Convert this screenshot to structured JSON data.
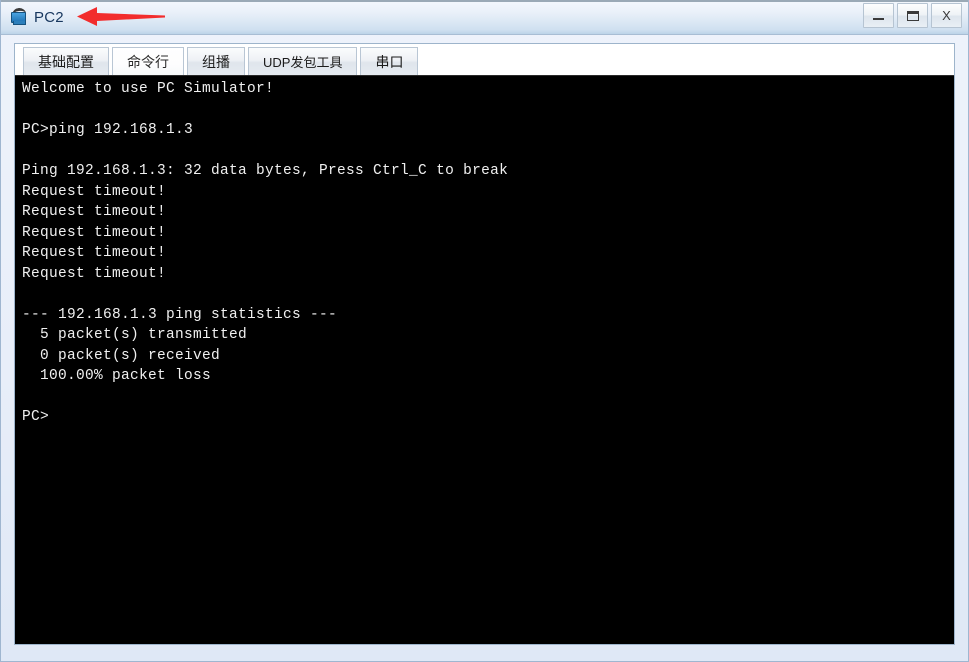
{
  "window": {
    "title": "PC2",
    "icon": "pc-computer-icon",
    "annotation_arrow_color": "#f22d2d",
    "controls": {
      "minimize": "–",
      "maximize": "□",
      "close": "X"
    }
  },
  "tabs": [
    {
      "label": "基础配置",
      "active": false,
      "name": "tab-basic-config"
    },
    {
      "label": "命令行",
      "active": true,
      "name": "tab-command-line"
    },
    {
      "label": "组播",
      "active": false,
      "name": "tab-multicast"
    },
    {
      "label": "UDP发包工具",
      "active": false,
      "name": "tab-udp-tool"
    },
    {
      "label": "串口",
      "active": false,
      "name": "tab-serial-port"
    }
  ],
  "terminal": {
    "background": "#000000",
    "foreground": "#f0f0f0",
    "lines": [
      "Welcome to use PC Simulator!",
      "",
      "PC>ping 192.168.1.3",
      "",
      "Ping 192.168.1.3: 32 data bytes, Press Ctrl_C to break",
      "Request timeout!",
      "Request timeout!",
      "Request timeout!",
      "Request timeout!",
      "Request timeout!",
      "",
      "--- 192.168.1.3 ping statistics ---",
      "  5 packet(s) transmitted",
      "  0 packet(s) received",
      "  100.00% packet loss",
      "",
      "PC>"
    ]
  }
}
